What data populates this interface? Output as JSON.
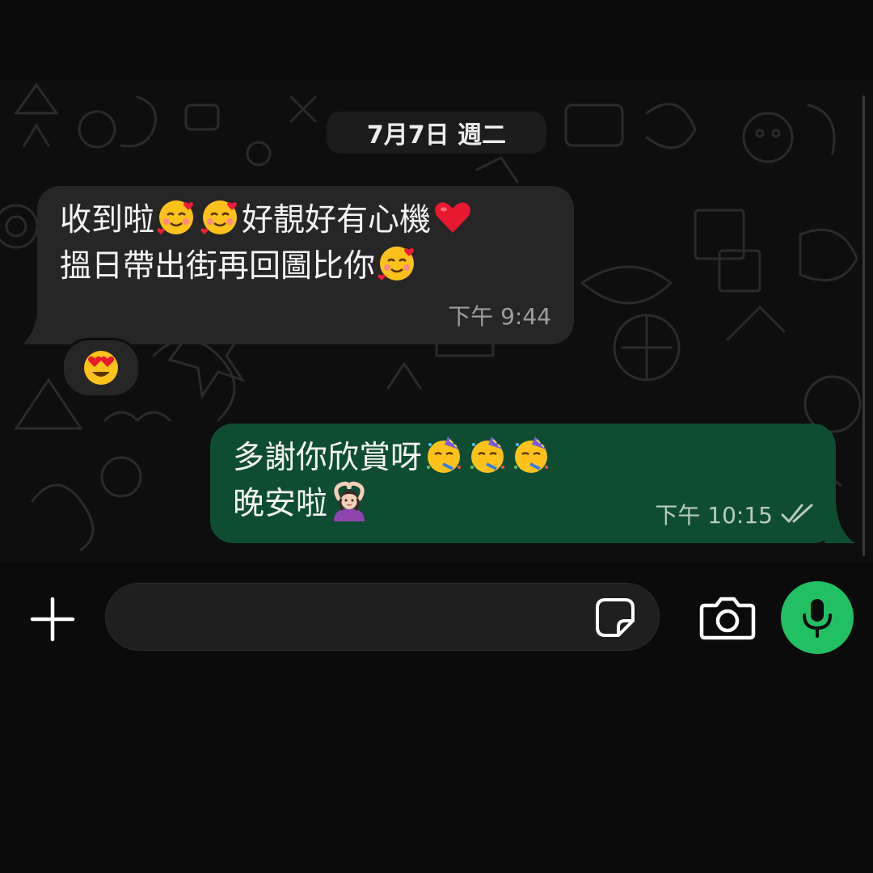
{
  "chat": {
    "date_separator": "7月7日 週二",
    "messages": [
      {
        "direction": "incoming",
        "lines": [
          {
            "segments": [
              {
                "t": "text",
                "v": "收到啦"
              },
              {
                "t": "emoji",
                "v": "smiling-face-with-hearts"
              },
              {
                "t": "emoji",
                "v": "smiling-face-with-hearts"
              },
              {
                "t": "text",
                "v": "好靚好有心機"
              },
              {
                "t": "emoji",
                "v": "red-heart"
              }
            ]
          },
          {
            "segments": [
              {
                "t": "text",
                "v": "搵日帶出街再回圖比你"
              },
              {
                "t": "emoji",
                "v": "smiling-face-with-hearts"
              }
            ]
          }
        ],
        "time": "下午 9:44",
        "reaction": "heart-eyes"
      },
      {
        "direction": "outgoing",
        "lines": [
          {
            "segments": [
              {
                "t": "text",
                "v": "多謝你欣賞呀"
              },
              {
                "t": "emoji",
                "v": "partying-face"
              },
              {
                "t": "emoji",
                "v": "partying-face"
              },
              {
                "t": "emoji",
                "v": "partying-face"
              }
            ]
          },
          {
            "segments": [
              {
                "t": "text",
                "v": "晚安啦"
              },
              {
                "t": "emoji",
                "v": "person-gesturing-ok"
              }
            ]
          }
        ],
        "time": "下午 10:15",
        "status": "read-double-check"
      }
    ]
  },
  "composer": {
    "placeholder": "",
    "value": "",
    "icons": {
      "attach": "plus-icon",
      "sticker": "sticker-icon",
      "camera": "camera-icon",
      "mic": "microphone-icon"
    }
  },
  "colors": {
    "incoming_bubble": "#262626",
    "outgoing_bubble": "#0f4d33",
    "mic_button": "#21c063",
    "background": "#0b0b0b"
  }
}
